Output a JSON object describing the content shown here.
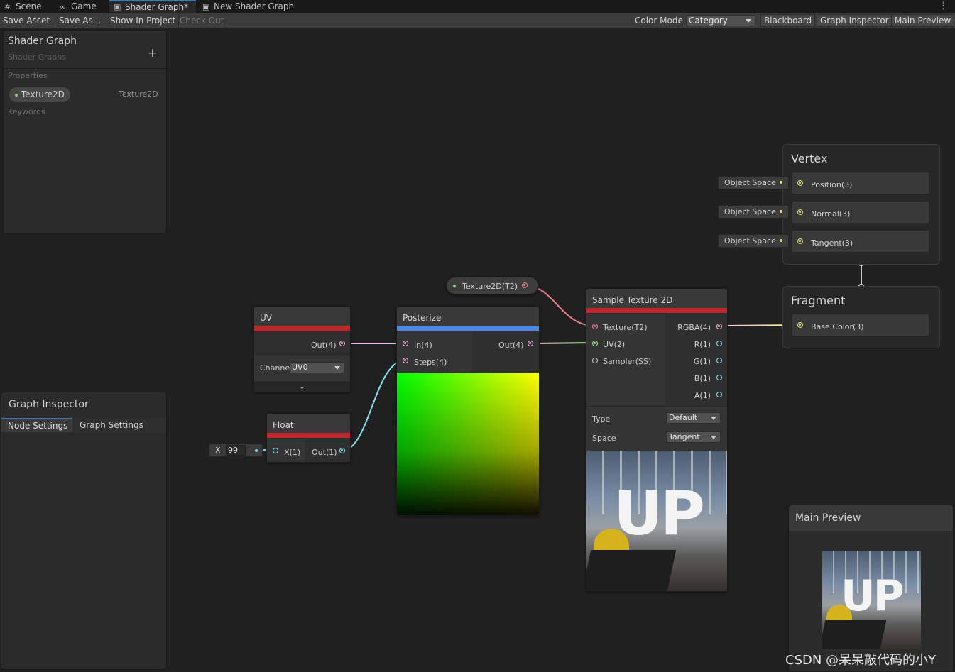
{
  "tabs": [
    {
      "label": "Scene",
      "icon": "#",
      "active": false
    },
    {
      "label": "Game",
      "icon": "∞",
      "active": false
    },
    {
      "label": "Shader Graph*",
      "icon": "▣",
      "active": true
    },
    {
      "label": "New Shader Graph",
      "icon": "▣",
      "active": false
    }
  ],
  "tab_menu_icon": "⋮",
  "toolbar": {
    "save_asset": "Save Asset",
    "save_as": "Save As...",
    "show_in_project": "Show In Project",
    "check_out": "Check Out",
    "color_mode_label": "Color Mode",
    "color_mode_value": "Category",
    "blackboard": "Blackboard",
    "graph_inspector": "Graph Inspector",
    "main_preview": "Main Preview"
  },
  "blackboard": {
    "title": "Shader Graph",
    "subtitle": "Shader Graphs",
    "add_icon": "+",
    "properties_label": "Properties",
    "property": {
      "name": "Texture2D",
      "type": "Texture2D"
    },
    "keywords_label": "Keywords"
  },
  "inspector": {
    "title": "Graph Inspector",
    "tab_node": "Node Settings",
    "tab_graph": "Graph Settings"
  },
  "nodes": {
    "uv": {
      "title": "UV",
      "bar_color": "#c0272d",
      "out": "Out(4)",
      "channel_label": "Channe",
      "channel_value": "UV0",
      "expand_icon": "⌄"
    },
    "float": {
      "title": "Float",
      "bar_color": "#c0272d",
      "in": "X(1)",
      "out": "Out(1)",
      "x_label": "X",
      "x_value": "99"
    },
    "posterize": {
      "title": "Posterize",
      "bar_color": "#4a89e8",
      "in": "In(4)",
      "steps": "Steps(4)",
      "out": "Out(4)"
    },
    "texture_prop": {
      "label": "Texture2D(T2)"
    },
    "sample": {
      "title": "Sample Texture 2D",
      "bar_color": "#c0272d",
      "inputs": [
        "Texture(T2)",
        "UV(2)",
        "Sampler(SS)"
      ],
      "outputs": [
        "RGBA(4)",
        "R(1)",
        "G(1)",
        "B(1)",
        "A(1)"
      ],
      "type_label": "Type",
      "type_value": "Default",
      "space_label": "Space",
      "space_value": "Tangent",
      "preview_text": "UP"
    }
  },
  "vertex": {
    "title": "Vertex",
    "blocks": [
      {
        "label": "Position(3)",
        "field": "Object Space"
      },
      {
        "label": "Normal(3)",
        "field": "Object Space"
      },
      {
        "label": "Tangent(3)",
        "field": "Object Space"
      }
    ]
  },
  "fragment": {
    "title": "Fragment",
    "blocks": [
      {
        "label": "Base Color(3)"
      }
    ]
  },
  "main_preview": {
    "title": "Main Preview",
    "preview_text": "UP"
  },
  "watermark": "CSDN @呆呆敲代码的小Y",
  "colors": {
    "accent_tab": "#3a79bb",
    "texture_port": "#f27d8f",
    "vector4_port": "#f2b8e4",
    "vector2_port": "#9df28b",
    "float_port": "#84e4f2",
    "vector3_port": "#f2f28b",
    "property_dot": "#8ed16e"
  }
}
